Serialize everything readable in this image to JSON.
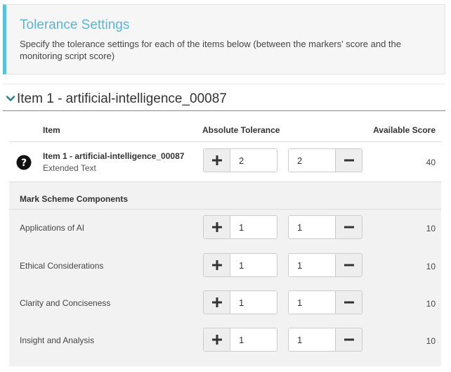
{
  "info": {
    "title": "Tolerance Settings",
    "description": "Specify the tolerance settings for each of the items below (between the markers' score and the monitoring script score)"
  },
  "item_heading": "Item 1 - artificial-intelligence_00087",
  "table": {
    "col_item": "Item",
    "col_tolerance": "Absolute Tolerance",
    "col_score": "Available Score"
  },
  "item": {
    "name": "Item 1 - artificial-intelligence_00087",
    "type": "Extended Text",
    "tol_upper": "2",
    "tol_lower": "2",
    "score": "40"
  },
  "components": {
    "heading": "Mark Scheme Components",
    "rows": [
      {
        "label": "Applications of AI",
        "tol_upper": "1",
        "tol_lower": "1",
        "score": "10"
      },
      {
        "label": "Ethical Considerations",
        "tol_upper": "1",
        "tol_lower": "1",
        "score": "10"
      },
      {
        "label": "Clarity and Conciseness",
        "tol_upper": "1",
        "tol_lower": "1",
        "score": "10"
      },
      {
        "label": "Insight and Analysis",
        "tol_upper": "1",
        "tol_lower": "1",
        "score": "10"
      }
    ]
  },
  "colors": {
    "accent": "#5bc0de",
    "heading_line": "#4a9db7"
  },
  "icons": {
    "expand": "chevron-down-icon",
    "help": "question-circle-icon",
    "increase": "plus-icon",
    "decrease": "minus-icon"
  }
}
